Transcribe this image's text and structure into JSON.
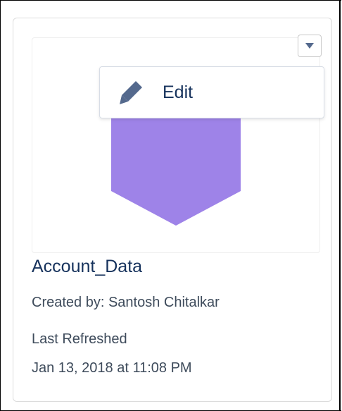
{
  "card": {
    "name": "Account_Data",
    "created_by": "Created by: Santosh Chitalkar",
    "last_refreshed_label": "Last Refreshed",
    "last_refreshed_value": "Jan 13, 2018 at 11:08 PM",
    "thumbnail_color": "#9e83e8"
  },
  "menu": {
    "toggle_icon": "chevron-down-icon",
    "items": [
      {
        "label": "Edit",
        "icon": "pencil-icon"
      }
    ]
  }
}
